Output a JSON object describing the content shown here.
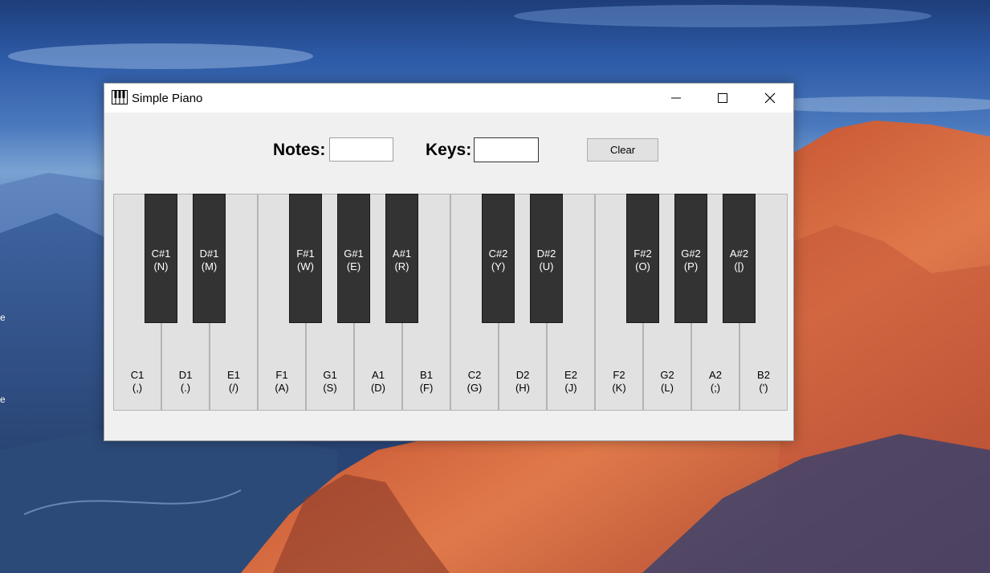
{
  "window": {
    "title": "Simple Piano"
  },
  "controls": {
    "minimize": "minimize-icon",
    "maximize": "maximize-icon",
    "close": "close-icon"
  },
  "toolbar": {
    "notes_label": "Notes:",
    "notes_value": "",
    "keys_label": "Keys:",
    "keys_value": "",
    "clear_label": "Clear"
  },
  "piano": {
    "white_keys": [
      {
        "note": "C1",
        "key": "(,)"
      },
      {
        "note": "D1",
        "key": "(.)"
      },
      {
        "note": "E1",
        "key": "(/)"
      },
      {
        "note": "F1",
        "key": "(A)"
      },
      {
        "note": "G1",
        "key": "(S)"
      },
      {
        "note": "A1",
        "key": "(D)"
      },
      {
        "note": "B1",
        "key": "(F)"
      },
      {
        "note": "C2",
        "key": "(G)"
      },
      {
        "note": "D2",
        "key": "(H)"
      },
      {
        "note": "E2",
        "key": "(J)"
      },
      {
        "note": "F2",
        "key": "(K)"
      },
      {
        "note": "G2",
        "key": "(L)"
      },
      {
        "note": "A2",
        "key": "(;)"
      },
      {
        "note": "B2",
        "key": "(')"
      }
    ],
    "black_keys": [
      {
        "note": "C#1",
        "key": "(N)"
      },
      {
        "note": "D#1",
        "key": "(M)"
      },
      {
        "note": "F#1",
        "key": "(W)"
      },
      {
        "note": "G#1",
        "key": "(E)"
      },
      {
        "note": "A#1",
        "key": "(R)"
      },
      {
        "note": "C#2",
        "key": "(Y)"
      },
      {
        "note": "D#2",
        "key": "(U)"
      },
      {
        "note": "F#2",
        "key": "(O)"
      },
      {
        "note": "G#2",
        "key": "(P)"
      },
      {
        "note": "A#2",
        "key": "([)"
      }
    ]
  },
  "desktop": {
    "fragments": [
      "e",
      "e"
    ]
  },
  "colors": {
    "white_key": "#e1e1e1",
    "black_key": "#333333",
    "window_bg": "#f0f0f0"
  }
}
